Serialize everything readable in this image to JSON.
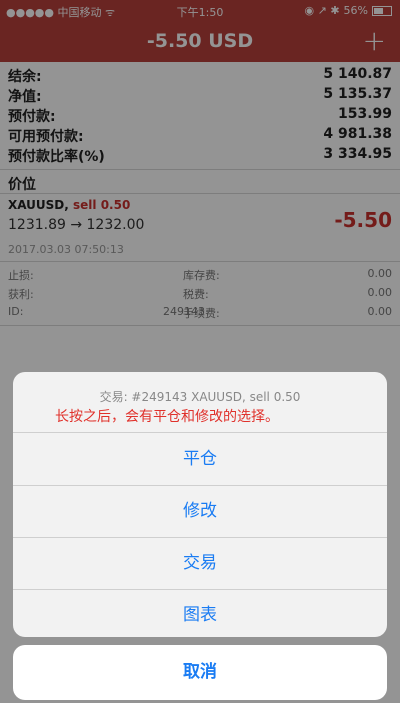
{
  "status_bar": {
    "carrier": "●●●●● 中国移动 ᯤ",
    "time": "下午1:50",
    "icons": "◉ ↗ ✱",
    "battery_pct": "56%",
    "battery_level": 0.56
  },
  "nav": {
    "title": "-5.50 USD",
    "plus_label": "+"
  },
  "account": {
    "rows": [
      {
        "label": "结余:",
        "value": "5 140.87"
      },
      {
        "label": "净值:",
        "value": "5 135.37"
      },
      {
        "label": "预付款:",
        "value": "153.99"
      },
      {
        "label": "可用预付款:",
        "value": "4 981.38"
      },
      {
        "label": "预付款比率(%)",
        "value": "3 334.95"
      }
    ]
  },
  "positions_title": "价位",
  "position": {
    "symbol": "XAUUSD,",
    "side": "sell 0.50",
    "prices": "1231.89 → 1232.00",
    "profit": "-5.50",
    "time": "2017.03.03 07:50:13",
    "details": [
      {
        "k1": "止损:",
        "v1": "-",
        "k2": "库存费:",
        "v2": "0.00"
      },
      {
        "k1": "获利:",
        "v1": "-",
        "k2": "税费:",
        "v2": "0.00"
      },
      {
        "k1": "ID:",
        "v1": "249143",
        "k2": "手续费:",
        "v2": "0.00"
      }
    ]
  },
  "sheet": {
    "trade_label": "交易: #249143 XAUUSD, sell 0.50",
    "note": "长按之后，会有平仓和修改的选择。",
    "actions": [
      "平仓",
      "修改",
      "交易",
      "图表"
    ],
    "cancel": "取消"
  },
  "colors": {
    "nav_bg": "#b7403c",
    "sell_red": "#c9312e",
    "note_red": "#e0312b",
    "action_blue": "#1a7cf3"
  }
}
